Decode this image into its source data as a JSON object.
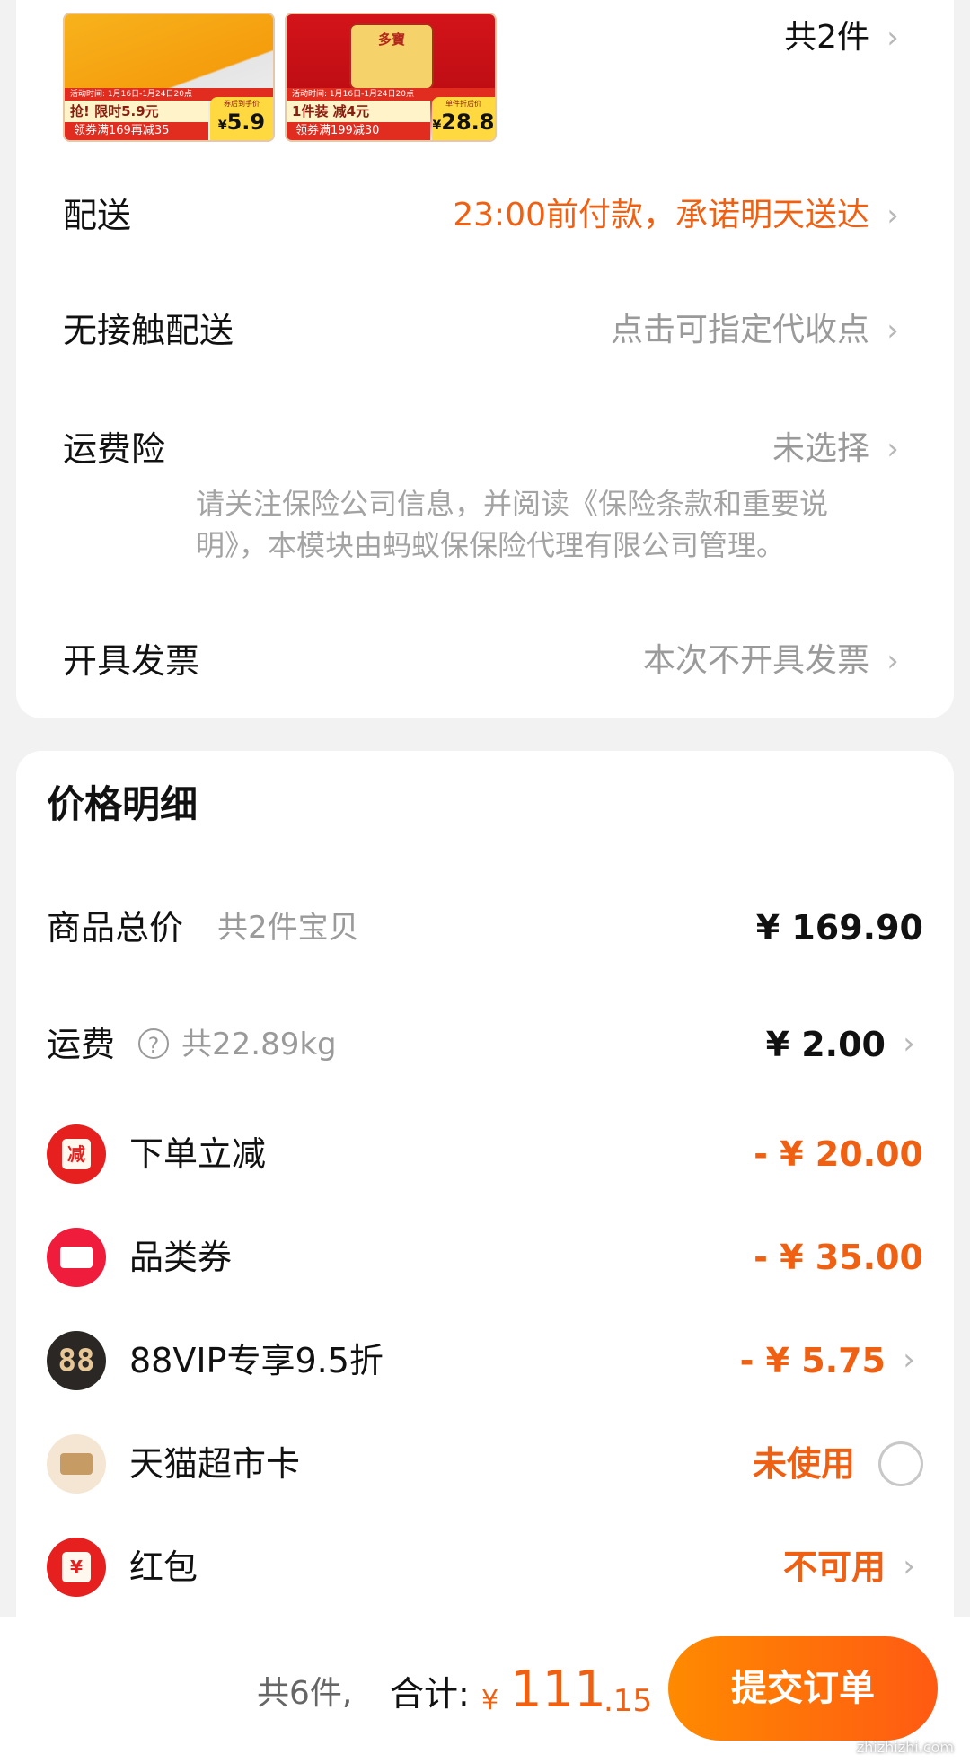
{
  "products": [
    {
      "strip": "活动时间: 1月16日-1月24日20点",
      "promo": "抢! 限时5.9元",
      "coupon": "领券满169再减35",
      "price_caption": "券后到手价",
      "price_currency": "¥",
      "price": "5.9"
    },
    {
      "hero": "多寶",
      "strip": "活动时间: 1月16日-1月24日20点",
      "promo": "1件装 减4元",
      "coupon": "领券满199减30",
      "price_caption": "单件折后价",
      "price_currency": "¥",
      "price": "28.8"
    }
  ],
  "order": {
    "item_count": "共2件",
    "delivery": {
      "label": "配送",
      "value": "23:00前付款，承诺明天送达"
    },
    "contactless": {
      "label": "无接触配送",
      "value": "点击可指定代收点"
    },
    "shipping_insurance": {
      "label": "运费险",
      "value": "未选择",
      "note": "请关注保险公司信息，并阅读《保险条款和重要说明》，本模块由蚂蚁保保险代理有限公司管理。"
    },
    "invoice": {
      "label": "开具发票",
      "value": "本次不开具发票"
    }
  },
  "price_detail": {
    "title": "价格明细",
    "items_total": {
      "label": "商品总价",
      "sub": "共2件宝贝",
      "amount": "¥ 169.90"
    },
    "shipping": {
      "label": "运费",
      "help_icon": "?",
      "sub": "共22.89kg",
      "amount": "¥ 2.00"
    },
    "instant_discount": {
      "icon_char": "减",
      "label": "下单立减",
      "amount": "- ¥ 20.00"
    },
    "category_coupon": {
      "label": "品类券",
      "amount": "- ¥ 35.00"
    },
    "vip": {
      "icon_char": "88",
      "label": "88VIP专享9.5折",
      "amount": "- ¥ 5.75"
    },
    "supermarket_card": {
      "label": "天猫超市卡",
      "status": "未使用"
    },
    "red_packet": {
      "icon_char": "¥",
      "label": "红包",
      "status": "不可用"
    }
  },
  "bottom_bar": {
    "count": "共6件,",
    "total_label": "合计:",
    "currency": "¥",
    "total_int": "111",
    "total_dec": ".15",
    "submit": "提交订单",
    "watermark": "zhizhizhi.com"
  },
  "colors": {
    "accent": "#f06012",
    "muted": "#9a9a9a",
    "background": "#f2f2f2"
  }
}
